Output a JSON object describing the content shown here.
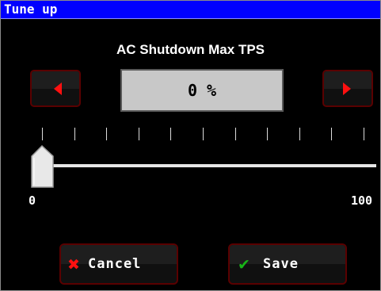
{
  "window": {
    "title": "Tune up"
  },
  "parameter": {
    "name": "AC Shutdown Max TPS",
    "value_display": "0 %",
    "value": 0,
    "min": 0,
    "max": 100,
    "min_label": "0",
    "max_label": "100",
    "tick_count": 11
  },
  "controls": {
    "decrement_icon": "left-arrow-icon",
    "increment_icon": "right-arrow-icon"
  },
  "actions": {
    "cancel_label": "Cancel",
    "cancel_icon": "x-icon",
    "save_label": "Save",
    "save_icon": "checkmark-icon"
  },
  "colors": {
    "titlebar": "#0000ff",
    "button_border": "#5a0000",
    "arrow": "#ff1010",
    "cancel_icon": "#ff1010",
    "save_icon": "#18b418"
  }
}
